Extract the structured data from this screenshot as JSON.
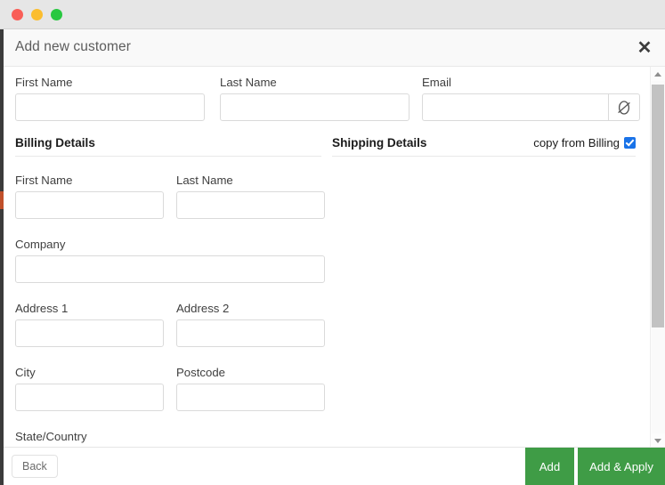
{
  "window": {
    "traffic_lights": [
      {
        "name": "close",
        "color": "#f95e57"
      },
      {
        "name": "minimize",
        "color": "#fbbd2e"
      },
      {
        "name": "maximize",
        "color": "#28c840"
      }
    ]
  },
  "modal": {
    "title": "Add new customer",
    "close_icon": "✕"
  },
  "top_fields": [
    {
      "id": "first_name",
      "label": "First Name",
      "value": "",
      "placeholder": ""
    },
    {
      "id": "last_name",
      "label": "Last Name",
      "value": "",
      "placeholder": ""
    },
    {
      "id": "email",
      "label": "Email",
      "value": "",
      "placeholder": "",
      "addon_icon": "Ø",
      "addon_icon_name": "no-email-icon"
    }
  ],
  "billing": {
    "heading": "Billing Details",
    "fields": [
      {
        "id": "billing_first_name",
        "label": "First Name",
        "value": ""
      },
      {
        "id": "billing_last_name",
        "label": "Last Name",
        "value": ""
      },
      {
        "id": "billing_company",
        "label": "Company",
        "value": ""
      },
      {
        "id": "billing_address_1",
        "label": "Address 1",
        "value": ""
      },
      {
        "id": "billing_address_2",
        "label": "Address 2",
        "value": ""
      },
      {
        "id": "billing_city",
        "label": "City",
        "value": ""
      },
      {
        "id": "billing_postcode",
        "label": "Postcode",
        "value": ""
      },
      {
        "id": "billing_state_country",
        "label": "State/Country",
        "value": ""
      }
    ]
  },
  "shipping": {
    "heading": "Shipping Details",
    "copy_from_billing_label": "copy from Billing",
    "copy_from_billing_checked": true,
    "checkbox_color": "#1a73e8"
  },
  "footer": {
    "back_label": "Back",
    "add_label": "Add",
    "add_apply_label": "Add & Apply",
    "cta_color": "#3f9c46"
  },
  "scrollbar": {
    "up_arrow": "up-arrow",
    "down_arrow": "down-arrow",
    "thumb": "scroll-thumb"
  }
}
